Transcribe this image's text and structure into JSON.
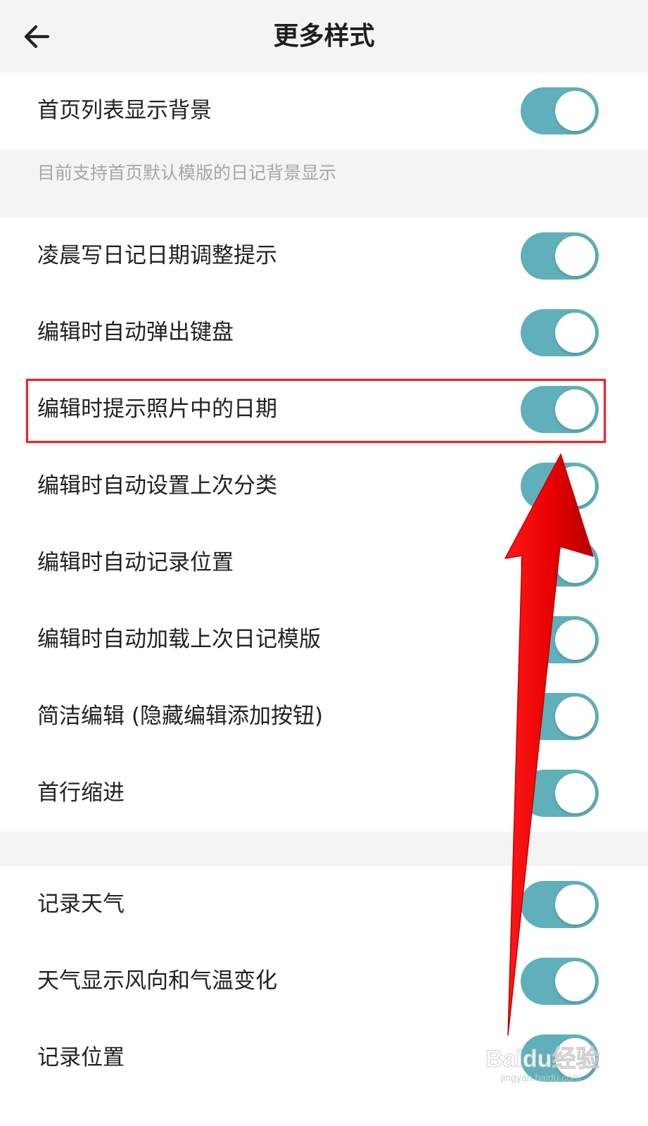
{
  "header": {
    "title": "更多样式",
    "back_icon": "arrow-left-icon"
  },
  "section1": {
    "items": [
      {
        "label": "首页列表显示背景",
        "enabled": true
      }
    ],
    "hint": "目前支持首页默认模版的日记背景显示"
  },
  "section2": {
    "items": [
      {
        "label": "凌晨写日记日期调整提示",
        "enabled": true
      },
      {
        "label": "编辑时自动弹出键盘",
        "enabled": true
      },
      {
        "label": "编辑时提示照片中的日期",
        "enabled": true
      },
      {
        "label": "编辑时自动设置上次分类",
        "enabled": true
      },
      {
        "label": "编辑时自动记录位置",
        "enabled": true
      },
      {
        "label": "编辑时自动加载上次日记模版",
        "enabled": true
      },
      {
        "label": "简洁编辑 (隐藏编辑添加按钮)",
        "enabled": true
      },
      {
        "label": "首行缩进",
        "enabled": true
      }
    ]
  },
  "section3": {
    "items": [
      {
        "label": "记录天气",
        "enabled": true
      },
      {
        "label": "天气显示风向和气温变化",
        "enabled": true
      },
      {
        "label": "记录位置",
        "enabled": true
      }
    ]
  },
  "annotation": {
    "highlighted_item": "编辑时提示照片中的日期",
    "color": "#e5262b"
  },
  "watermark": {
    "brand": "Baidu经验",
    "site": "jingyan.baidu.com"
  },
  "colors": {
    "toggle_on": "#5fb0ba",
    "background": "#f4f4f4",
    "annotation": "#e5262b"
  }
}
